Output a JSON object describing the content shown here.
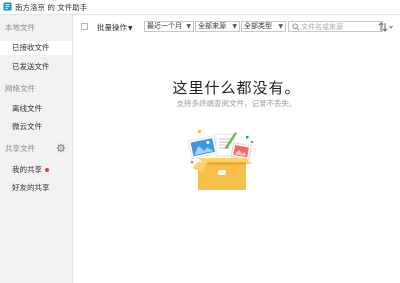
{
  "window": {
    "title": "南方洛京 的 文件助手"
  },
  "sidebar": {
    "local_header": "本地文件",
    "local_items": [
      {
        "label": "已接收文件"
      },
      {
        "label": "已发送文件"
      }
    ],
    "cloud_header": "网络文件",
    "cloud_items": [
      {
        "label": "离线文件"
      },
      {
        "label": "微云文件"
      }
    ],
    "shared_header": "共享文件",
    "shared_items": [
      {
        "label": "我的共享"
      },
      {
        "label": "好友的共享"
      }
    ]
  },
  "toolbar": {
    "batch_label": "批量操作",
    "time_filter": "最近一个月",
    "source_filter": "全部来源",
    "type_filter": "全部类型",
    "search_placeholder": "文件名或来源"
  },
  "empty_state": {
    "title": "这里什么都没有。",
    "subtitle": "支持多终端查阅文件，记录不丢失。"
  },
  "colors": {
    "accent": "#1296db",
    "notify_dot": "#e8402d",
    "box": "#f7c04a"
  }
}
